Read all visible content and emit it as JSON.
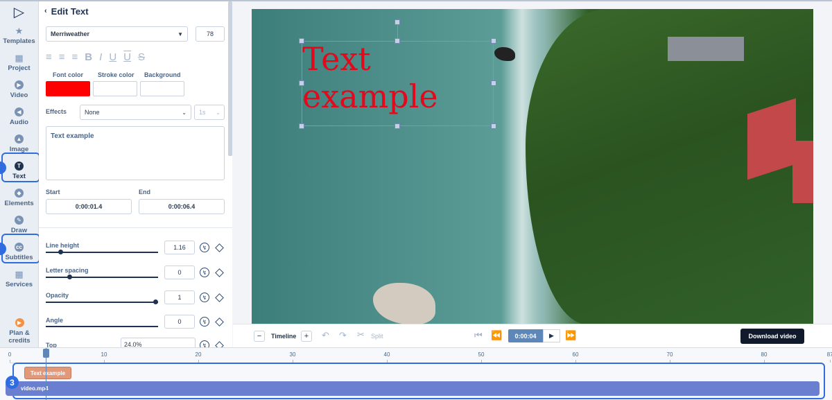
{
  "sidebar": {
    "items": [
      {
        "label": "Templates",
        "icon": "star-icon"
      },
      {
        "label": "Project",
        "icon": "grid-icon"
      },
      {
        "label": "Video",
        "icon": "play-icon"
      },
      {
        "label": "Audio",
        "icon": "audio-icon"
      },
      {
        "label": "Image",
        "icon": "image-icon"
      },
      {
        "label": "Text",
        "icon": "text-icon"
      },
      {
        "label": "Elements",
        "icon": "elements-icon"
      },
      {
        "label": "Draw",
        "icon": "pencil-icon"
      },
      {
        "label": "Subtitles",
        "icon": "cc-icon"
      },
      {
        "label": "Services",
        "icon": "services-icon"
      }
    ],
    "plan_label_1": "Plan &",
    "plan_label_2": "credits"
  },
  "panel": {
    "title": "Edit Text",
    "font": "Merriweather",
    "font_size": "78",
    "font_color_label": "Font color",
    "stroke_color_label": "Stroke color",
    "background_label": "Background",
    "font_color": "#ff0000",
    "effects_label": "Effects",
    "effect_value": "None",
    "effect_duration": "1s",
    "text_value": "Text example",
    "start_label": "Start",
    "end_label": "End",
    "start_value": "0:00:01.4",
    "end_value": "0:00:06.4",
    "line_height_label": "Line height",
    "line_height_value": "1.16",
    "letter_spacing_label": "Letter spacing",
    "letter_spacing_value": "0",
    "opacity_label": "Opacity",
    "opacity_value": "1",
    "angle_label": "Angle",
    "angle_value": "0",
    "top_label": "Top",
    "top_value": "24.0%"
  },
  "preview": {
    "overlay_text_line1": "Text",
    "overlay_text_line2": "example"
  },
  "controls": {
    "timeline_label": "Timeline",
    "split_label": "Split",
    "current_time": "0:00:04",
    "download_label": "Download video"
  },
  "timeline": {
    "ticks": [
      "0",
      "10",
      "20",
      "30",
      "40",
      "50",
      "60",
      "70",
      "80",
      "87"
    ],
    "text_clip_label": "Text example",
    "video_clip_label": "video.mp4"
  },
  "badges": {
    "timeline_badge": "3"
  }
}
